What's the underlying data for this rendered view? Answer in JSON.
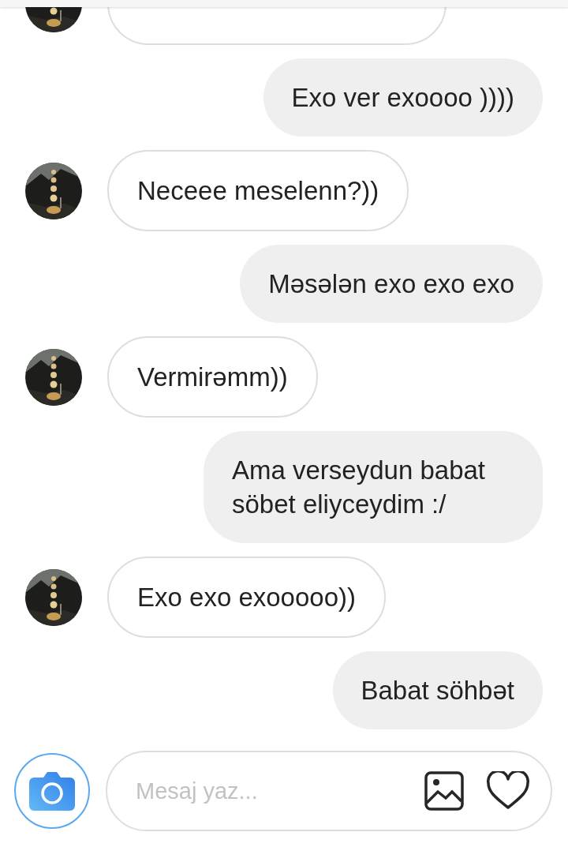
{
  "messages": [
    {
      "kind": "received"
    },
    {
      "kind": "sent",
      "text": "Exo ver exoooo ))))"
    },
    {
      "kind": "received",
      "text": "Neceee meselenn?))"
    },
    {
      "kind": "sent",
      "text": "Məsələn exo exo exo"
    },
    {
      "kind": "received",
      "text": "Vermirəmm))"
    },
    {
      "kind": "sent",
      "text": "Ama verseydun babat söbet eliyceydim :/"
    },
    {
      "kind": "received",
      "text": "Exo exo exooooo))"
    },
    {
      "kind": "sent",
      "text": "Babat söhbət"
    }
  ],
  "composer": {
    "placeholder": "Mesaj yaz..."
  }
}
